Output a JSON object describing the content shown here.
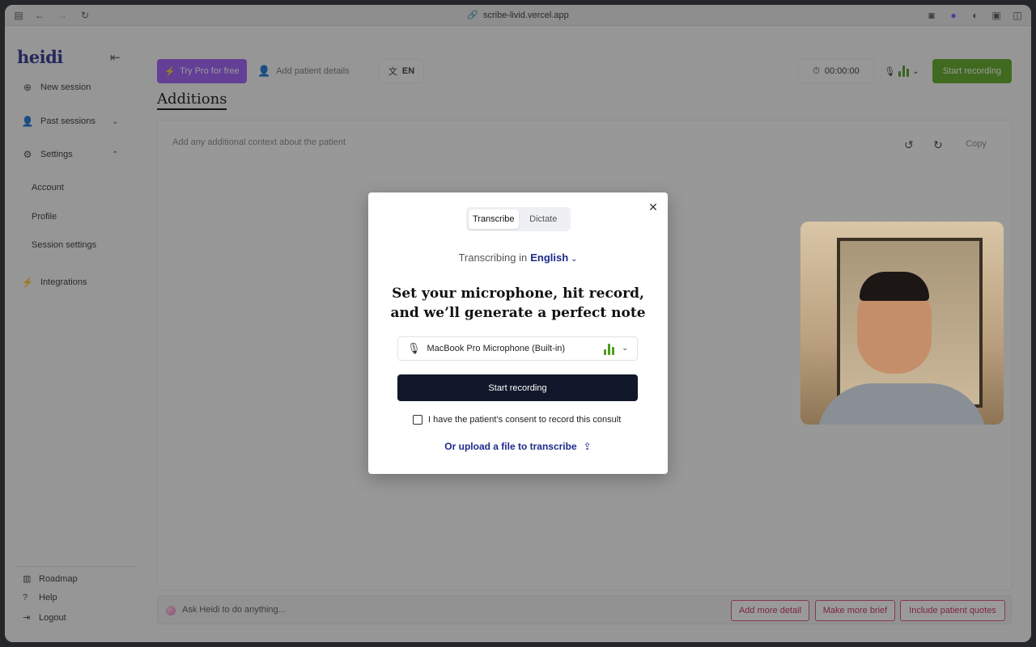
{
  "browser": {
    "url": "scribe-livid.vercel.app"
  },
  "sidebar": {
    "logo": "heidi",
    "items": [
      {
        "label": "New session"
      },
      {
        "label": "Past sessions"
      },
      {
        "label": "Settings"
      }
    ],
    "settings_sub": [
      {
        "label": "Account"
      },
      {
        "label": "Profile"
      },
      {
        "label": "Session settings"
      }
    ],
    "integrations": "Integrations",
    "footer": [
      {
        "label": "Roadmap"
      },
      {
        "label": "Help"
      },
      {
        "label": "Logout"
      }
    ]
  },
  "toolbar": {
    "try_pro": "Try Pro for free",
    "patient_placeholder": "Add patient details",
    "language": "EN",
    "timer": "00:00:00",
    "start_recording": "Start recording"
  },
  "main": {
    "title": "Additions",
    "editor_placeholder": "Add any additional context about the patient",
    "copy": "Copy",
    "ask_placeholder": "Ask Heidi to do anything...",
    "chips": [
      "Add more detail",
      "Make more brief",
      "Include patient quotes"
    ]
  },
  "modal": {
    "tabs": [
      "Transcribe",
      "Dictate"
    ],
    "active_tab": "Transcribe",
    "transcribing_in": "Transcribing in",
    "language": "English",
    "headline": "Set your microphone, hit record, and we’ll generate a perfect note",
    "microphone": "MacBook Pro Microphone (Built-in)",
    "start_recording": "Start recording",
    "consent": "I have the patient’s consent to record this consult",
    "consent_checked": false,
    "upload": "Or upload a file to transcribe"
  },
  "colors": {
    "brand": "#2a2f8a",
    "pro": "#9b59f5",
    "record_green": "#5aa81e",
    "primary_dark": "#11182b",
    "chip_red": "#c62f55"
  }
}
